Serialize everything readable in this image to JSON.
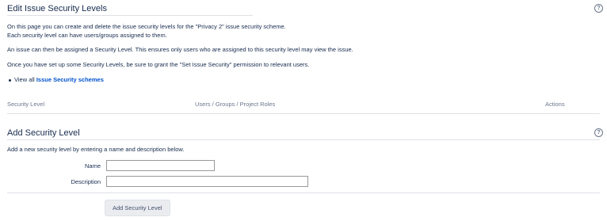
{
  "edit_section": {
    "title": "Edit Issue Security Levels",
    "help_icon": "help-icon",
    "intro_line1": "On this page you can create and delete the issue security levels for the \"Privacy 2\" issue security scheme.",
    "intro_line2": "Each security level can have users/groups assigned to them.",
    "assign_text": "An issue can then be assigned a Security Level. This ensures only users who are assigned to this security level may view the issue.",
    "permission_text": "Once you have set up some Security Levels, be sure to grant the \"Set Issue Security\" permission to relevant users.",
    "view_all_prefix": "View all",
    "view_all_link": "Issue Security schemes"
  },
  "table": {
    "columns": [
      "Security Level",
      "Users / Groups / Project Roles",
      "Actions"
    ]
  },
  "add_section": {
    "title": "Add Security Level",
    "help_icon": "help-icon",
    "description": "Add a new security level by entering a name and description below.",
    "name_label": "Name",
    "name_value": "",
    "description_label": "Description",
    "description_value": "",
    "submit_label": "Add Security Level"
  },
  "colors": {
    "link": "#0052cc",
    "text": "#172b4d",
    "muted": "#6b778c",
    "button_bg": "#ebecf0"
  }
}
